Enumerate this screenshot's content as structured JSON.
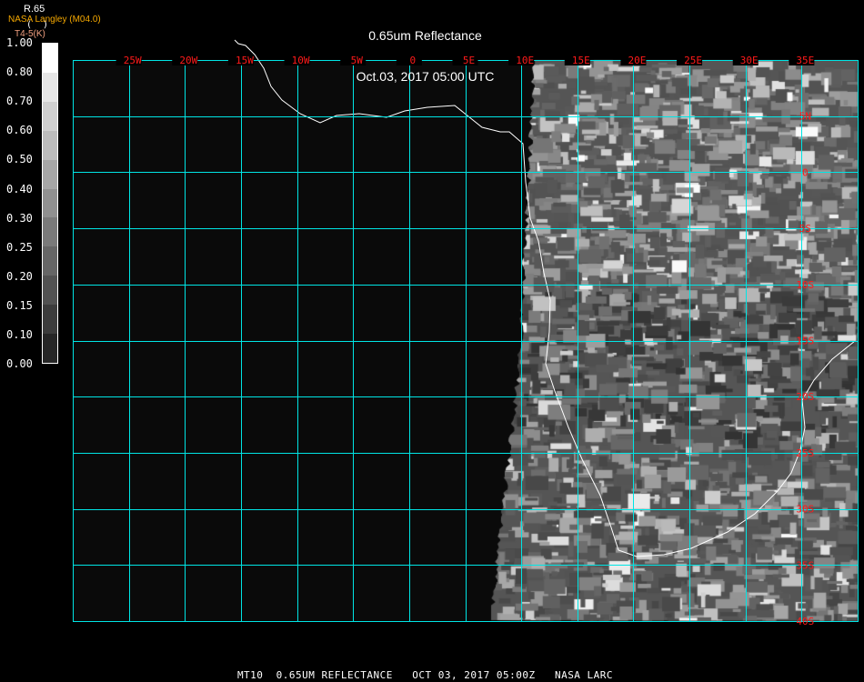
{
  "header": {
    "title": "0.65um Reflectance",
    "datetime": "Oct.03, 2017 05:00 UTC"
  },
  "legend": {
    "organization": "NASA Langley (M04.0)",
    "variable": "R.65",
    "unit": "(  )",
    "alt_variable": "T4-5(K)",
    "labels": [
      "1.00",
      "0.80",
      "0.70",
      "0.60",
      "0.50",
      "0.40",
      "0.30",
      "0.25",
      "0.20",
      "0.15",
      "0.10",
      "0.00"
    ],
    "colors": [
      "#ffffff",
      "#e6e6e6",
      "#d0d0d0",
      "#bcbcbc",
      "#a6a6a6",
      "#909090",
      "#7a7a7a",
      "#666666",
      "#525252",
      "#3c3c3c",
      "#262626"
    ]
  },
  "map": {
    "lon_labels": [
      "25W",
      "20W",
      "15W",
      "10W",
      "5W",
      "0",
      "5E",
      "10E",
      "15E",
      "20E",
      "25E",
      "30E",
      "35E"
    ],
    "lat_labels": [
      "5N",
      "0",
      "5S",
      "10S",
      "15S",
      "20S",
      "25S",
      "30S",
      "35S",
      "40S"
    ],
    "grid_color": "#00e5e5",
    "label_color": "#ff1a1a",
    "coast_color": "#ffffff"
  },
  "footer": {
    "text": "MT10  0.65UM REFLECTANCE   OCT 03, 2017 05:00Z   NASA LARC"
  }
}
